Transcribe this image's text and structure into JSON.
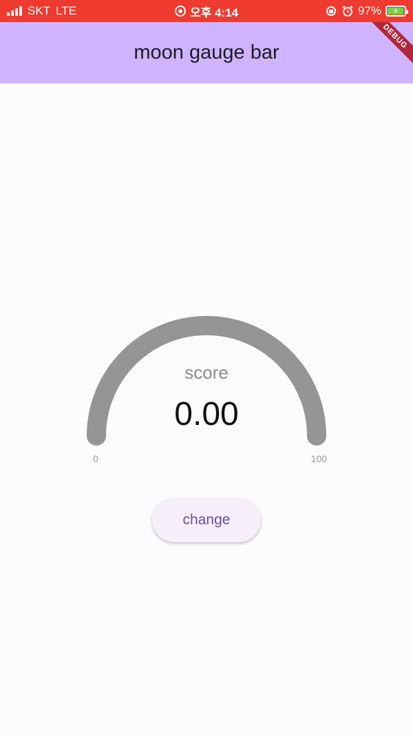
{
  "status_bar": {
    "carrier": "SKT",
    "network": "LTE",
    "time": "오후 4:14",
    "battery_percent": "97%"
  },
  "app_bar": {
    "title": "moon gauge bar",
    "debug_banner": "DEBUG"
  },
  "gauge": {
    "label": "score",
    "value_text": "0.00",
    "value": 0,
    "min_label": "0",
    "max_label": "100",
    "min": 0,
    "max": 100,
    "track_color": "#959497"
  },
  "actions": {
    "change_label": "change"
  },
  "colors": {
    "status_bar": "#ef3a2f",
    "app_bar": "#d0b3ff",
    "button_text": "#6750a4",
    "button_bg": "#f6effa",
    "background": "#fefbff"
  }
}
